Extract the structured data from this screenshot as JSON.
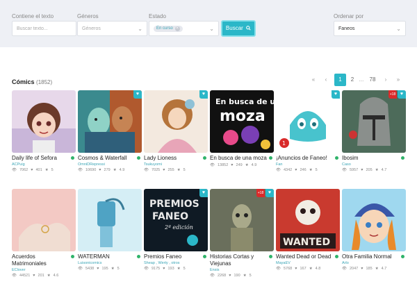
{
  "filters": {
    "text_label": "Contiene el texto",
    "text_placeholder": "Buscar texto...",
    "genres_label": "Géneros",
    "genres_placeholder": "Géneros",
    "state_label": "Estado",
    "state_chip": "En curso",
    "search_button": "Buscar",
    "order_label": "Ordenar por",
    "order_value": "Faneos"
  },
  "section": {
    "title": "Cómics",
    "count": "(1852)"
  },
  "pagination": {
    "current": "1",
    "next": "2",
    "ellipsis": "...",
    "last": "78"
  },
  "colors": {
    "accent": "#2bb7c8",
    "online": "#2fb36a",
    "adult": "#d92b2b"
  },
  "comics": [
    {
      "title": "Daily life of Sefora",
      "author": "ACPuig",
      "views": "7062",
      "likes": "401",
      "stars": "5",
      "badges": []
    },
    {
      "title": "Cosmos & Waterfall",
      "author": "OmniDRepressi",
      "views": "10690",
      "likes": "279",
      "stars": "4.9",
      "badges": [
        "heart"
      ]
    },
    {
      "title": "Lady Lioness",
      "author": "Tsukuyomi",
      "views": "7025",
      "likes": "255",
      "stars": "5",
      "badges": [
        "heart"
      ]
    },
    {
      "title": "En busca de una moza",
      "author": "Pol00",
      "views": "13852",
      "likes": "249",
      "stars": "4.9",
      "badges": []
    },
    {
      "title": "¡Anuncios de Faneo!",
      "author": "Fan",
      "views": "4342",
      "likes": "246",
      "stars": "5",
      "badges": [
        "heart"
      ]
    },
    {
      "title": "Ibosim",
      "author": "Caso",
      "views": "5957",
      "likes": "205",
      "stars": "4.7",
      "badges": [
        "+18",
        "heart"
      ]
    },
    {
      "title": "Acuerdos Matrimoniales",
      "author": "EClover",
      "views": "44521",
      "likes": "201",
      "stars": "4.6",
      "badges": []
    },
    {
      "title": "WATERMAN",
      "author": "Luisonicomics",
      "views": "5438",
      "likes": "195",
      "stars": "5",
      "badges": []
    },
    {
      "title": "Premios Faneo",
      "author": "Sheap , Werty , otros",
      "views": "9175",
      "likes": "193",
      "stars": "5",
      "badges": [
        "heart"
      ]
    },
    {
      "title": "Historias Cortas y Viejunas",
      "author": "Ensis",
      "views": "2268",
      "likes": "190",
      "stars": "5",
      "badges": [
        "+18",
        "heart"
      ]
    },
    {
      "title": "Wanted Dead or Dead",
      "author": "MayaEV",
      "views": "5768",
      "likes": "167",
      "stars": "4.8",
      "badges": []
    },
    {
      "title": "Otra Familia Normal",
      "author": "Arlo",
      "views": "2047",
      "likes": "185",
      "stars": "4.7",
      "badges": []
    }
  ]
}
